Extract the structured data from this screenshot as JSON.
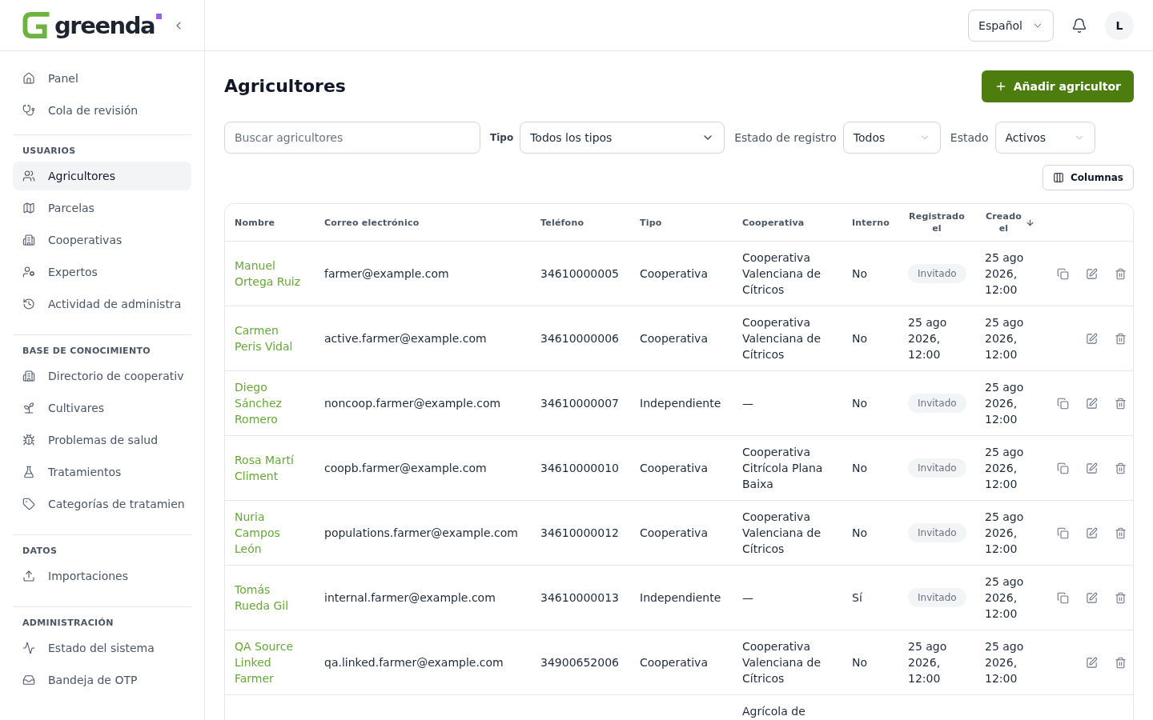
{
  "sidebar": {
    "logo_text": "greenda",
    "sections": [
      {
        "items": [
          {
            "label": "Panel",
            "selected": false
          },
          {
            "label": "Cola de revisión",
            "selected": false
          }
        ]
      },
      {
        "heading": "USUARIOS",
        "items": [
          {
            "label": "Agricultores",
            "selected": true
          },
          {
            "label": "Parcelas",
            "selected": false
          },
          {
            "label": "Cooperativas",
            "selected": false
          },
          {
            "label": "Expertos",
            "selected": false
          },
          {
            "label": "Actividad de administra",
            "selected": false
          }
        ]
      },
      {
        "heading": "BASE DE CONOCIMIENTO",
        "items": [
          {
            "label": "Directorio de cooperativ",
            "selected": false
          },
          {
            "label": "Cultivares",
            "selected": false
          },
          {
            "label": "Problemas de salud",
            "selected": false
          },
          {
            "label": "Tratamientos",
            "selected": false
          },
          {
            "label": "Categorías de tratamien",
            "selected": false
          }
        ]
      },
      {
        "heading": "DATOS",
        "items": [
          {
            "label": "Importaciones",
            "selected": false
          }
        ]
      },
      {
        "heading": "ADMINISTRACIÓN",
        "items": [
          {
            "label": "Estado del sistema",
            "selected": false
          },
          {
            "label": "Bandeja de OTP",
            "selected": false
          }
        ]
      }
    ]
  },
  "topbar": {
    "language": "Español",
    "avatar": "L"
  },
  "header": {
    "title": "Agricultores",
    "add_button": "Añadir agricultor"
  },
  "filters": {
    "search": {
      "placeholder": "Buscar agricultores"
    },
    "selects": [
      {
        "label": "Tipo",
        "kind": "strong",
        "value": "Todos los tipos"
      },
      {
        "label": "Estado de registro",
        "kind": "plain",
        "value": "Todos"
      },
      {
        "label": "Estado",
        "kind": "plain",
        "value": "Activos"
      }
    ]
  },
  "columns_button": "Columnas",
  "table": {
    "columns": [
      {
        "label": "Nombre",
        "sorted": false
      },
      {
        "label": "Correo electrónico",
        "sorted": false
      },
      {
        "label": "Teléfono",
        "sorted": false
      },
      {
        "label": "Tipo",
        "sorted": false
      },
      {
        "label": "Cooperativa",
        "sorted": false
      },
      {
        "label": "Interno",
        "sorted": false
      },
      {
        "label": "Registrado el",
        "sorted": false
      },
      {
        "label": "Creado el",
        "sorted": true
      }
    ],
    "rows": [
      {
        "kind": "full",
        "name": "Manuel Ortega Ruiz",
        "email": "farmer@example.com",
        "phone": "34610000005",
        "type": "Cooperativa",
        "cooperative": "Cooperativa Valenciana de Cítricos",
        "internal": "No",
        "registered": {
          "kind": "badge",
          "text": "Invitado"
        },
        "created": "25 ago 2026, 12:00",
        "copy_action": true
      },
      {
        "kind": "full",
        "name": "Carmen Peris Vidal",
        "email": "active.farmer@example.com",
        "phone": "34610000006",
        "type": "Cooperativa",
        "cooperative": "Cooperativa Valenciana de Cítricos",
        "internal": "No",
        "registered": {
          "kind": "date",
          "text": "25 ago 2026, 12:00"
        },
        "created": "25 ago 2026, 12:00",
        "copy_action": false
      },
      {
        "kind": "full",
        "name": "Diego Sánchez Romero",
        "email": "noncoop.farmer@example.com",
        "phone": "34610000007",
        "type": "Independiente",
        "cooperative": "—",
        "internal": "No",
        "registered": {
          "kind": "badge",
          "text": "Invitado"
        },
        "created": "25 ago 2026, 12:00",
        "copy_action": true
      },
      {
        "kind": "full",
        "name": "Rosa Martí Climent",
        "email": "coopb.farmer@example.com",
        "phone": "34610000010",
        "type": "Cooperativa",
        "cooperative": "Cooperativa Citrícola Plana Baixa",
        "internal": "No",
        "registered": {
          "kind": "badge",
          "text": "Invitado"
        },
        "created": "25 ago 2026, 12:00",
        "copy_action": true
      },
      {
        "kind": "full",
        "name": "Nuria Campos León",
        "email": "populations.farmer@example.com",
        "phone": "34610000012",
        "type": "Cooperativa",
        "cooperative": "Cooperativa Valenciana de Cítricos",
        "internal": "No",
        "registered": {
          "kind": "badge",
          "text": "Invitado"
        },
        "created": "25 ago 2026, 12:00",
        "copy_action": true
      },
      {
        "kind": "full",
        "name": "Tomás Rueda Gil",
        "email": "internal.farmer@example.com",
        "phone": "34610000013",
        "type": "Independiente",
        "cooperative": "—",
        "internal": "Sí",
        "registered": {
          "kind": "badge",
          "text": "Invitado"
        },
        "created": "25 ago 2026, 12:00",
        "copy_action": true
      },
      {
        "kind": "full",
        "name": "QA Source Linked Farmer",
        "email": "qa.linked.farmer@example.com",
        "phone": "34900652006",
        "type": "Cooperativa",
        "cooperative": "Cooperativa Valenciana de Cítricos",
        "internal": "No",
        "registered": {
          "kind": "date",
          "text": "25 ago 2026, 12:00"
        },
        "created": "25 ago 2026, 12:00",
        "copy_action": false
      },
      {
        "kind": "partial",
        "cooperative": "Agrícola de"
      }
    ]
  }
}
